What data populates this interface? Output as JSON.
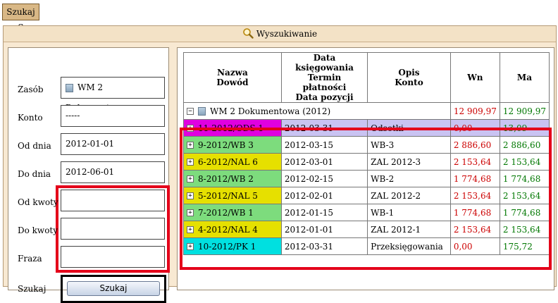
{
  "top_tab": {
    "label": "Szukaj S"
  },
  "panel": {
    "title": "Wyszukiwanie",
    "icon": "search-icon"
  },
  "form": {
    "zasob": {
      "label": "Zasób",
      "value": "WM 2 Dokumentowa",
      "icon": "building-icon"
    },
    "konto": {
      "label": "Konto",
      "value": "-----"
    },
    "od_dnia": {
      "label": "Od dnia",
      "value": "2012-01-01"
    },
    "do_dnia": {
      "label": "Do dnia",
      "value": "2012-06-01"
    },
    "od_kwoty": {
      "label": "Od kwoty",
      "value": ""
    },
    "do_kwoty": {
      "label": "Do kwoty",
      "value": ""
    },
    "fraza": {
      "label": "Fraza",
      "value": ""
    },
    "szukaj": {
      "label": "Szukaj",
      "button_label": "Szukaj"
    }
  },
  "table": {
    "headers": {
      "nazwa": "Nazwa",
      "dowod": "Dowód",
      "data1": "Data księgowania",
      "data2": "Termin płatności",
      "data3": "Data pozycji",
      "opis": "Opis",
      "konto": "Konto",
      "wn": "Wn",
      "ma": "Ma"
    },
    "group": {
      "label": "WM 2 Dokumentowa (2012)",
      "wn": "12 909,97",
      "ma": "12 909,97",
      "expander": "⊟"
    },
    "rows": [
      {
        "name": "11-2012/ODS 1",
        "date": "2012-03-31",
        "opis": "Odsetki",
        "wn": "0,00",
        "ma": "13,09",
        "color": "#e000e0"
      },
      {
        "name": "9-2012/WB 3",
        "date": "2012-03-15",
        "opis": "WB-3",
        "wn": "2 886,60",
        "ma": "2 886,60",
        "color": "#7ddc7d"
      },
      {
        "name": "6-2012/NAL 6",
        "date": "2012-03-01",
        "opis": "ZAL 2012-3",
        "wn": "2 153,64",
        "ma": "2 153,64",
        "color": "#e6e000"
      },
      {
        "name": "8-2012/WB 2",
        "date": "2012-02-15",
        "opis": "WB-2",
        "wn": "1 774,68",
        "ma": "1 774,68",
        "color": "#7ddc7d"
      },
      {
        "name": "5-2012/NAL 5",
        "date": "2012-02-01",
        "opis": "ZAL 2012-2",
        "wn": "2 153,64",
        "ma": "2 153,64",
        "color": "#e6e000"
      },
      {
        "name": "7-2012/WB 1",
        "date": "2012-01-15",
        "opis": "WB-1",
        "wn": "1 774,68",
        "ma": "1 774,68",
        "color": "#7ddc7d"
      },
      {
        "name": "4-2012/NAL 4",
        "date": "2012-01-01",
        "opis": "ZAL 2012-1",
        "wn": "2 153,64",
        "ma": "2 153,64",
        "color": "#e6e000"
      },
      {
        "name": "10-2012/PK 1",
        "date": "2012-03-31",
        "opis": "Przeksięgowania",
        "wn": "0,00",
        "ma": "175,72",
        "color": "#00e0e0"
      }
    ],
    "selected_row_bg": "#c9c3f2"
  },
  "colors": {
    "highlight": "#e4001a",
    "positive": "#007700",
    "negative": "#cc0000"
  }
}
